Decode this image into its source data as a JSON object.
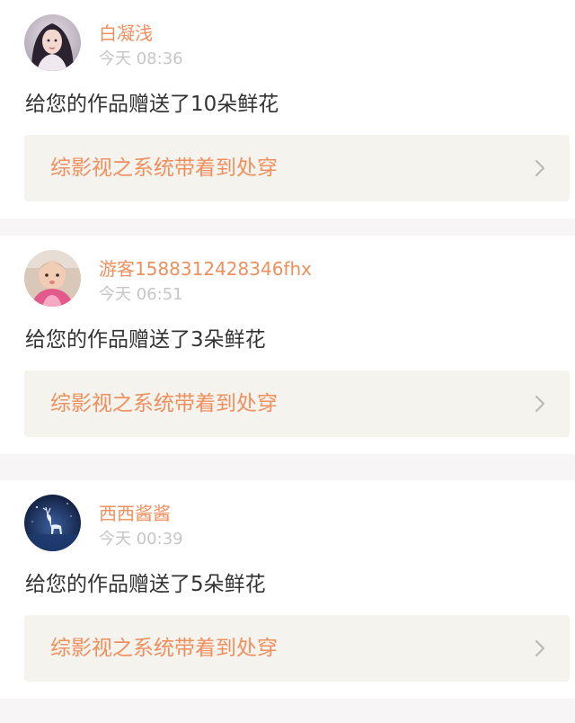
{
  "notifications": [
    {
      "username": "白凝浅",
      "time": "今天 08:36",
      "message": "给您的作品赠送了10朵鲜花",
      "book_title": "综影视之系统带着到处穿",
      "avatar_icon": "woman-portrait-avatar"
    },
    {
      "username": "游客1588312428346fhx",
      "time": "今天 06:51",
      "message": "给您的作品赠送了3朵鲜花",
      "book_title": "综影视之系统带着到处穿",
      "avatar_icon": "baby-photo-avatar"
    },
    {
      "username": "西西酱酱",
      "time": "今天 00:39",
      "message": "给您的作品赠送了5朵鲜花",
      "book_title": "综影视之系统带着到处穿",
      "avatar_icon": "night-deer-avatar"
    }
  ],
  "colors": {
    "accent": "#ef8f5e",
    "time": "#c6c6c6",
    "text": "#333333",
    "link_bg": "#f5f3ee",
    "page_bg": "#f7f5f5"
  }
}
